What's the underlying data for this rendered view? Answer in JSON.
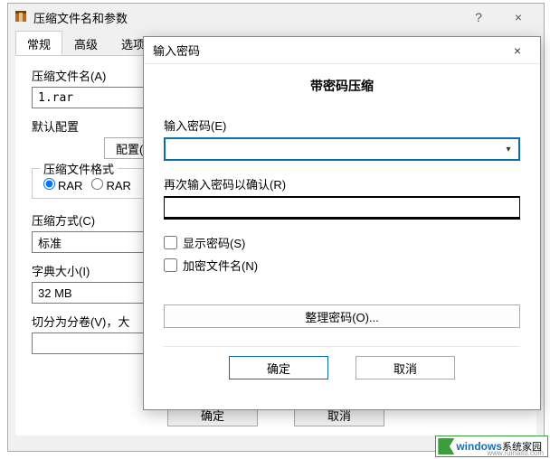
{
  "main": {
    "title": "压缩文件名和参数",
    "help_icon": "?",
    "close_icon": "×",
    "tabs": [
      "常规",
      "高级",
      "选项"
    ],
    "filename_label": "压缩文件名(A)",
    "filename_value": "1.rar",
    "default_config_label": "默认配置",
    "config_btn": "配置(F)",
    "format_legend": "压缩文件格式",
    "format_rar": "RAR",
    "format_rar2": "RAR",
    "method_label": "压缩方式(C)",
    "method_value": "标准",
    "dict_label": "字典大小(I)",
    "dict_value": "32 MB",
    "split_label": "切分为分卷(V)，大",
    "ok": "确定",
    "cancel": "取消"
  },
  "overlay": {
    "title": "输入密码",
    "close_icon": "×",
    "heading": "带密码压缩",
    "pw1_label": "输入密码(E)",
    "pw2_label": "再次输入密码以确认(R)",
    "show_pw": "显示密码(S)",
    "encrypt_names": "加密文件名(N)",
    "organize": "整理密码(O)...",
    "ok": "确定",
    "cancel": "取消"
  },
  "watermark": {
    "brand1": "windows",
    "brand2": "系统家园",
    "url": "www.ruinaitu.com"
  }
}
